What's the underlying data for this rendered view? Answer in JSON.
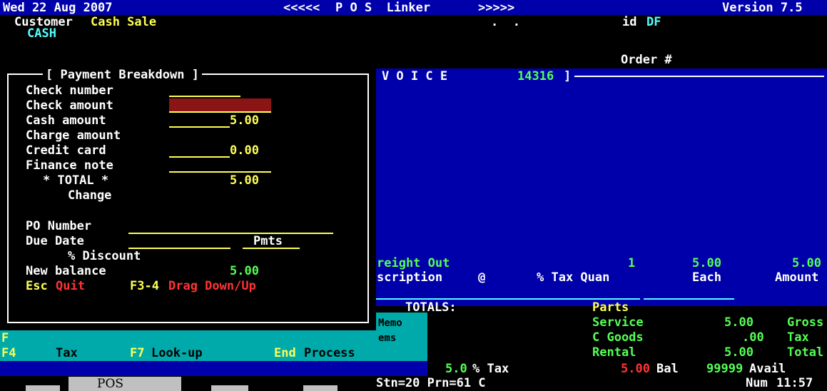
{
  "header": {
    "date": "Wed 22 Aug 2007",
    "arrows_left": "<<<<<",
    "app_title": "P O S  Linker",
    "arrows_right": ">>>>>",
    "version": "Version 7.5"
  },
  "customer": {
    "label": "Customer",
    "name": "Cash Sale",
    "code": "CASH",
    "dots": ".  .",
    "id_label": "id",
    "id_value": "DF",
    "order_label": "Order #"
  },
  "invoice": {
    "title": "I N V O I C E",
    "number": "14316",
    "bracket": "]"
  },
  "payment": {
    "title": "[ Payment Breakdown ]",
    "rows": [
      {
        "label": "Check number",
        "value": ""
      },
      {
        "label": "Check amount",
        "value": ""
      },
      {
        "label": "Cash amount",
        "value": "5.00"
      },
      {
        "label": "Charge amount",
        "value": ""
      },
      {
        "label": "Credit card",
        "value": "0.00"
      },
      {
        "label": "Finance note",
        "value": ""
      }
    ],
    "total_label": "* TOTAL *",
    "total_value": "5.00",
    "change_label": "Change",
    "po_label": "PO Number",
    "due_label": "Due Date",
    "pmts_label": "Pmts",
    "discount_label": "% Discount",
    "new_balance_label": "New balance",
    "new_balance_value": "5.00",
    "esc_key": "Esc",
    "quit_label": "Quit",
    "f34_key": "F3-4",
    "drag_label": "Drag Down/Up"
  },
  "line_item": {
    "desc": "reight Out",
    "qty": "1",
    "each": "5.00",
    "amount": "5.00"
  },
  "columns": {
    "description": "scription",
    "at": "@",
    "tax_quan": "% Tax Quan",
    "each": "Each",
    "amount": "Amount"
  },
  "totals": {
    "label": "TOTALS:",
    "memo": "Memo",
    "ems": "ems",
    "parts": "Parts",
    "service": "Service",
    "c_goods": "C Goods",
    "rental": "Rental",
    "gross_value": "5.00",
    "gross_label": "Gross",
    "tax_value": ".00",
    "tax_label": "Tax",
    "total_value": "5.00",
    "total_label": "Total"
  },
  "fkeys": {
    "f_label": "F",
    "f4": "F4",
    "tax": "Tax",
    "f7": "F7",
    "lookup": "Look-up",
    "end": "End",
    "process": "Process"
  },
  "status": {
    "tax_rate": "5.0",
    "tax_rate_label": "% Tax",
    "bal_value": "5.00",
    "bal_label": "Bal",
    "avail_value": "99999",
    "avail_label": "Avail",
    "station": "Stn=20 Prn=61 C",
    "num": "Num",
    "time": "11:57",
    "pos_tab": "POS"
  }
}
